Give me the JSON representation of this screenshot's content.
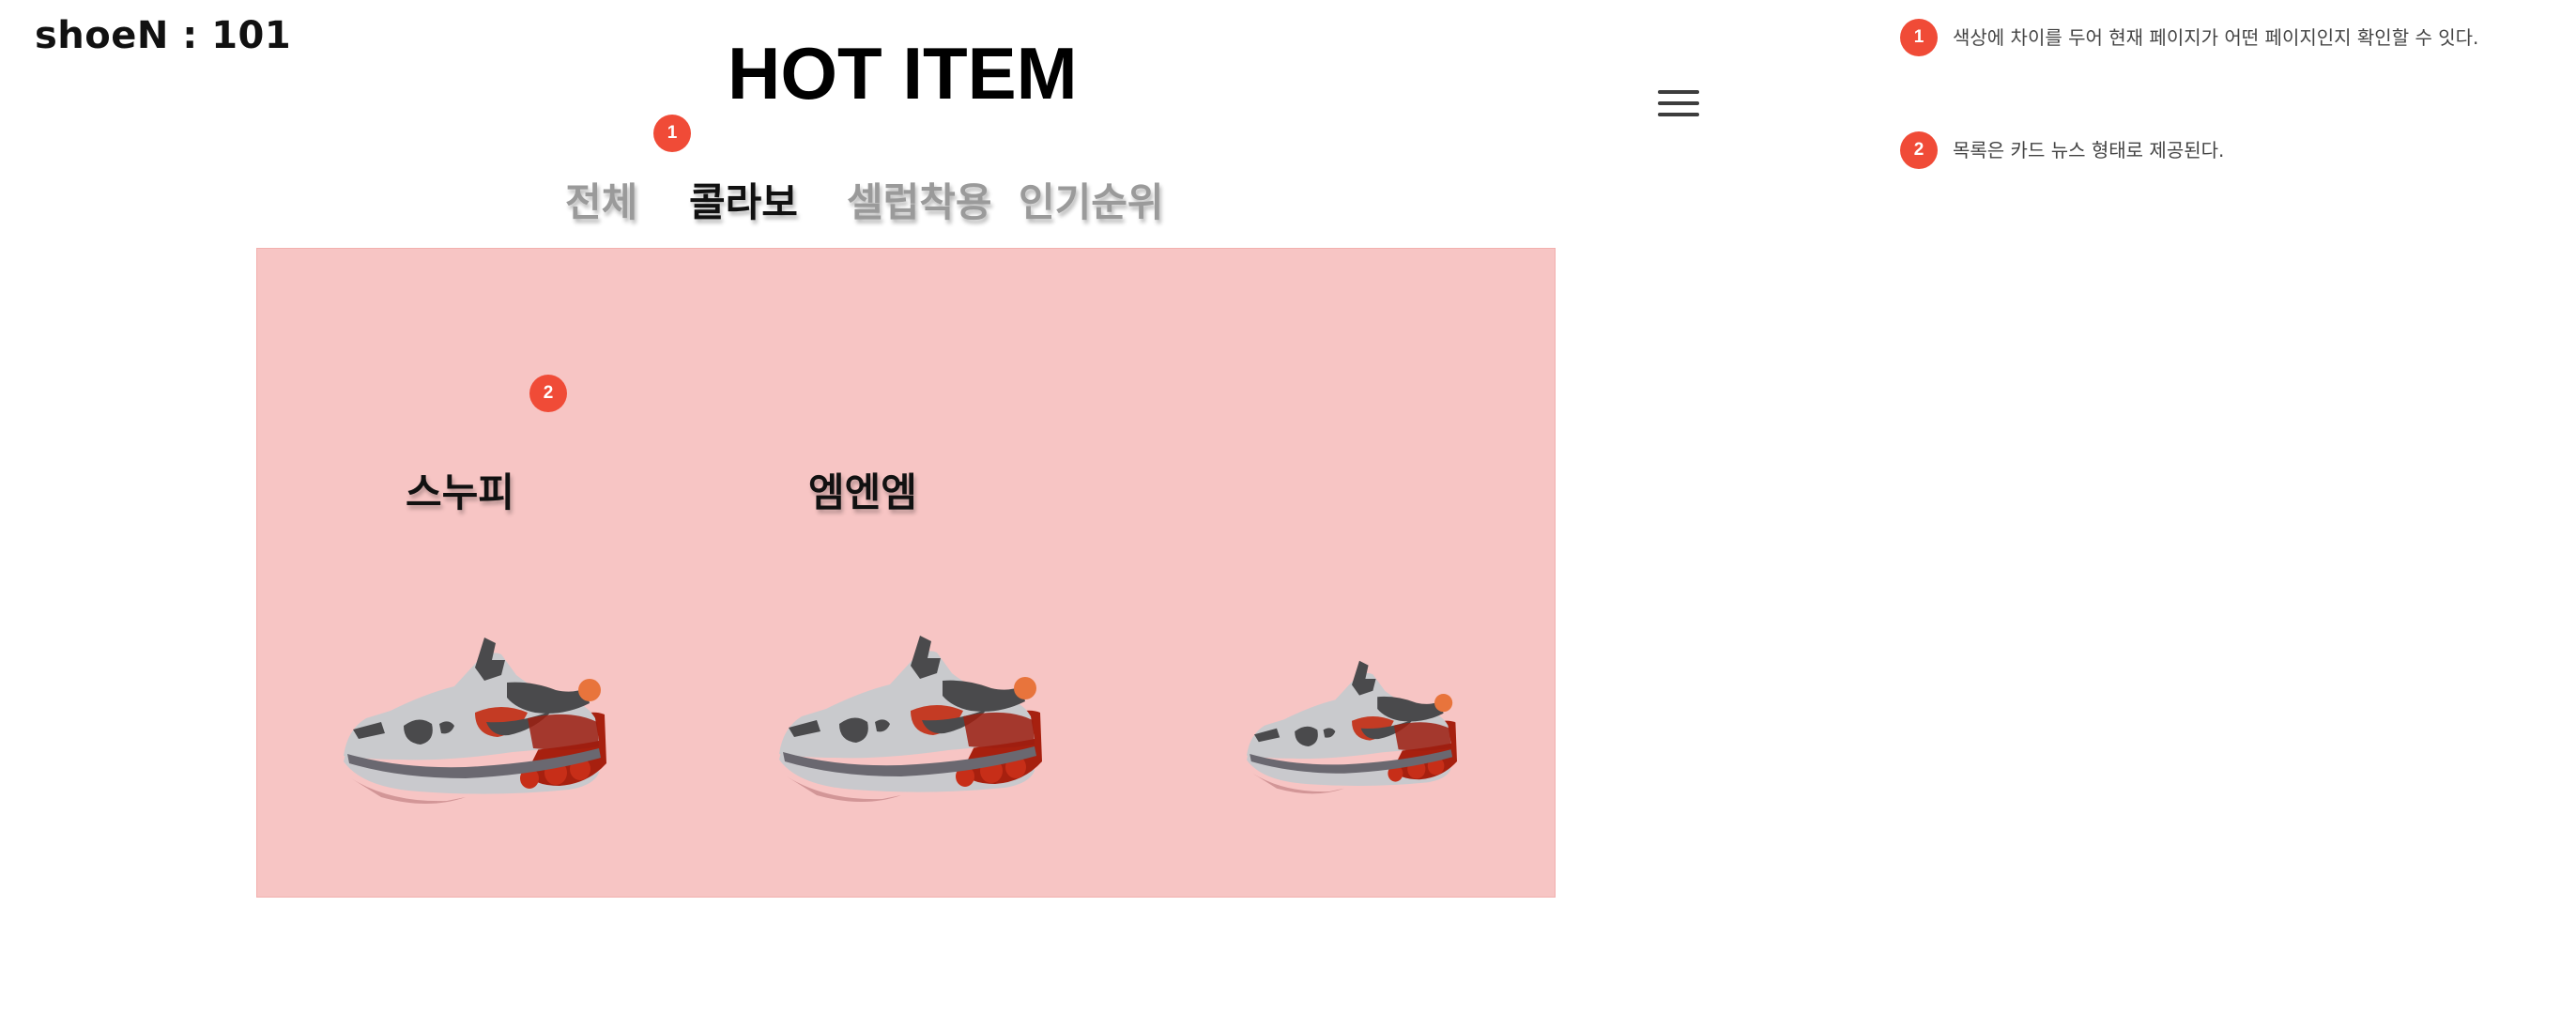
{
  "header": {
    "logo": "shoeN : 101",
    "title": "HOT ITEM",
    "menu_icon": "hamburger-menu-icon"
  },
  "tabs": [
    {
      "label": "전체",
      "active": false
    },
    {
      "label": "콜라보",
      "active": true
    },
    {
      "label": "셀럽착용",
      "active": false
    },
    {
      "label": "인기순위",
      "active": false
    }
  ],
  "cards": [
    {
      "title": "스누피",
      "image": "sneaker-image"
    },
    {
      "title": "엠엔엠",
      "image": "sneaker-image"
    },
    {
      "title": "",
      "image": "sneaker-image"
    }
  ],
  "markers": {
    "tabs": "1",
    "cards": "2"
  },
  "annotations": [
    {
      "number": "1",
      "text": "색상에 차이를 두어 현재 페이지가 어떤 페이지인지 확인할 수 잇다."
    },
    {
      "number": "2",
      "text": "목록은 카드 뉴스 형태로 제공된다."
    }
  ],
  "colors": {
    "marker": "#f04b37",
    "card_panel": "#f7c5c4",
    "active_tab": "#111111",
    "inactive_tab": "#9a9a9a"
  }
}
